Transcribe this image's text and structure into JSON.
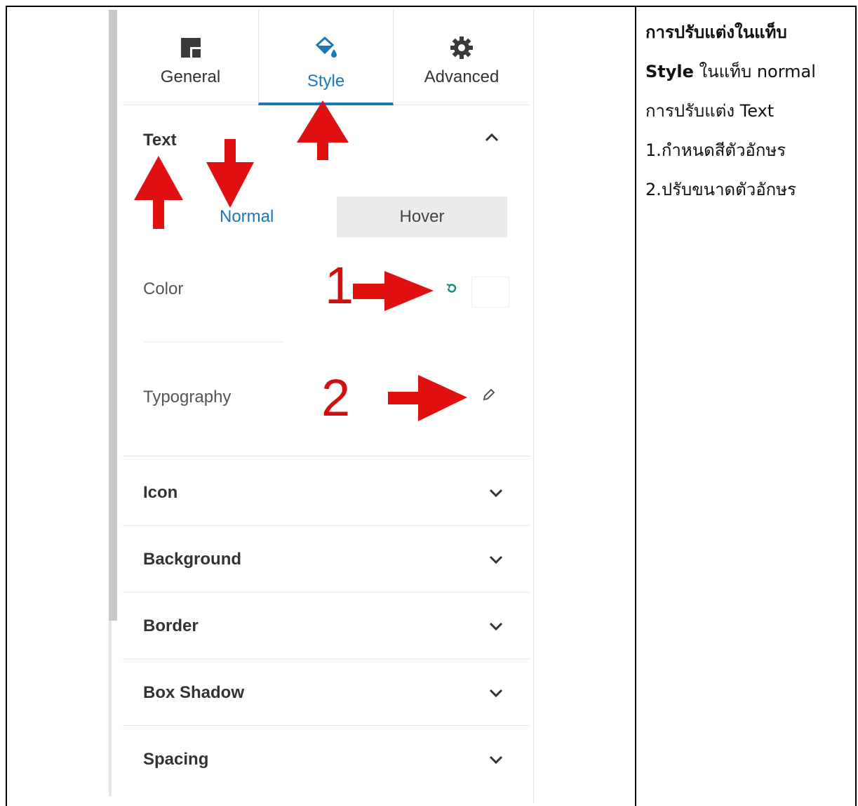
{
  "tabs": [
    {
      "label": "General",
      "icon": "general-icon"
    },
    {
      "label": "Style",
      "icon": "paint-bucket-icon"
    },
    {
      "label": "Advanced",
      "icon": "gear-icon"
    }
  ],
  "text_section": {
    "title": "Text",
    "state_tabs": {
      "normal": "Normal",
      "hover": "Hover"
    },
    "color_label": "Color",
    "typography_label": "Typography"
  },
  "sections": [
    "Icon",
    "Background",
    "Border",
    "Box Shadow",
    "Spacing"
  ],
  "annotations": {
    "one": "1",
    "two": "2"
  },
  "description": {
    "line1": "การปรับแต่งในแท็บ",
    "line2_bold": "Style",
    "line2_rest": " ในแท็บ normal",
    "line3": "การปรับแต่ง Text",
    "line4": "1.กำหนดสีตัวอักษร",
    "line5": "2.ปรับขนาดตัวอักษร"
  },
  "colors": {
    "accent": "#1a78b8",
    "annotation": "#d10f0f"
  }
}
